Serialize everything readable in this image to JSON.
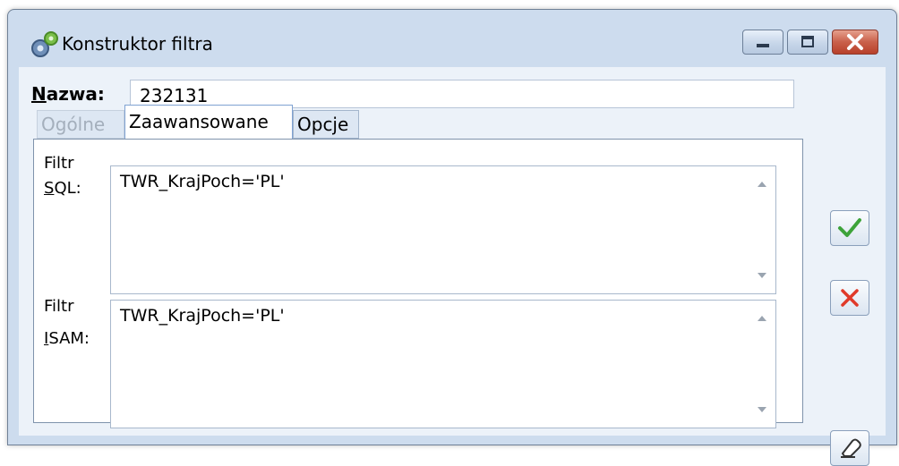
{
  "window": {
    "title": "Konstruktor filtra",
    "icons": {
      "app": "gear-icon",
      "minimize": "minimize-icon",
      "maximize": "maximize-icon",
      "close": "close-icon"
    }
  },
  "name": {
    "label_first": "N",
    "label_rest": "azwa:",
    "value": "232131"
  },
  "tabs": [
    {
      "label": "Ogólne",
      "state": "disabled"
    },
    {
      "label": "Zaawansowane",
      "state": "active"
    },
    {
      "label": "Opcje",
      "state": "normal"
    }
  ],
  "fields": {
    "sql": {
      "label_line1": "Filtr",
      "label_hotkey": "S",
      "label_rest": "QL:",
      "value": "TWR_KrajPoch='PL'"
    },
    "isam": {
      "label_line1": "Filtr",
      "label_hotkey": "I",
      "label_rest": "SAM:",
      "value": "TWR_KrajPoch='PL'"
    }
  },
  "buttons": {
    "ok_icon": "checkmark-icon",
    "cancel_icon": "x-icon",
    "clear_icon": "eraser-icon"
  },
  "colors": {
    "accent": "#7fa2d2",
    "ok": "#3da33a",
    "cancel": "#e03a2a",
    "close": "#c9604a"
  }
}
